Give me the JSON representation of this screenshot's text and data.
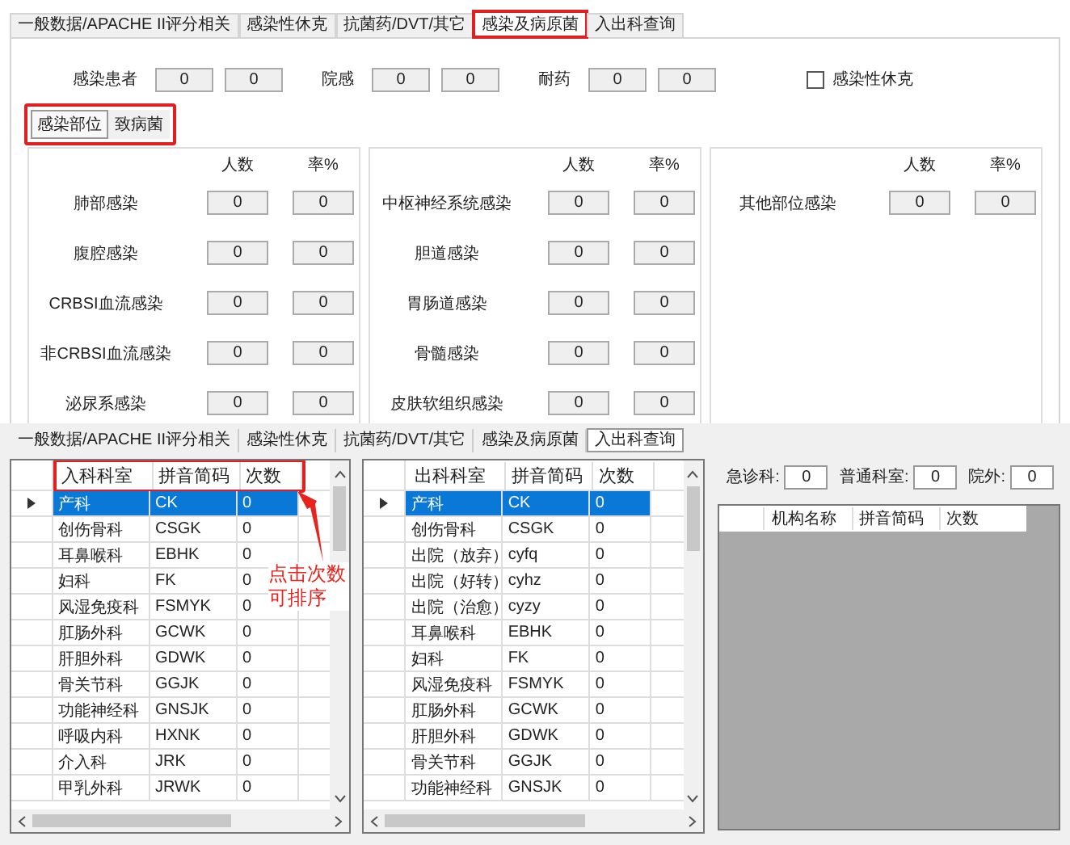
{
  "top": {
    "tabs": [
      {
        "label": "一般数据/APACHE II评分相关",
        "selected": false,
        "highlighted": false
      },
      {
        "label": "感染性休克",
        "selected": false,
        "highlighted": false
      },
      {
        "label": "抗菌药/DVT/其它",
        "selected": false,
        "highlighted": false
      },
      {
        "label": "感染及病原菌",
        "selected": true,
        "highlighted": true
      },
      {
        "label": "入出科查询",
        "selected": false,
        "highlighted": false
      }
    ],
    "counts": [
      {
        "label": "感染患者",
        "values": [
          "0",
          "0"
        ]
      },
      {
        "label": "院感",
        "values": [
          "0",
          "0"
        ]
      },
      {
        "label": "耐药",
        "values": [
          "0",
          "0"
        ]
      }
    ],
    "shock_checkbox": {
      "label": "感染性休克",
      "checked": false
    },
    "subtabs_highlighted": true,
    "subtabs": [
      {
        "label": "感染部位",
        "selected": true
      },
      {
        "label": "致病菌",
        "selected": false
      }
    ],
    "panels": [
      {
        "headers": [
          "人数",
          "率%"
        ],
        "rows": [
          {
            "label": "肺部感染",
            "values": [
              "0",
              "0"
            ]
          },
          {
            "label": "腹腔感染",
            "values": [
              "0",
              "0"
            ]
          },
          {
            "label": "CRBSI血流感染",
            "values": [
              "0",
              "0"
            ]
          },
          {
            "label": "非CRBSI血流感染",
            "values": [
              "0",
              "0"
            ]
          },
          {
            "label": "泌尿系感染",
            "values": [
              "0",
              "0"
            ]
          }
        ]
      },
      {
        "headers": [
          "人数",
          "率%"
        ],
        "rows": [
          {
            "label": "中枢神经系统感染",
            "values": [
              "0",
              "0"
            ]
          },
          {
            "label": "胆道感染",
            "values": [
              "0",
              "0"
            ]
          },
          {
            "label": "胃肠道感染",
            "values": [
              "0",
              "0"
            ]
          },
          {
            "label": "骨髓感染",
            "values": [
              "0",
              "0"
            ]
          },
          {
            "label": "皮肤软组织感染",
            "values": [
              "0",
              "0"
            ]
          }
        ]
      },
      {
        "headers": [
          "人数",
          "率%"
        ],
        "rows": [
          {
            "label": "其他部位感染",
            "values": [
              "0",
              "0"
            ]
          }
        ]
      }
    ]
  },
  "bottom": {
    "tabs": [
      {
        "label": "一般数据/APACHE II评分相关",
        "selected": false
      },
      {
        "label": "感染性休克",
        "selected": false
      },
      {
        "label": "抗菌药/DVT/其它",
        "selected": false
      },
      {
        "label": "感染及病原菌",
        "selected": false
      },
      {
        "label": "入出科查询",
        "selected": true
      }
    ],
    "grids": [
      {
        "header_highlighted": true,
        "columns": [
          "入科科室",
          "拼音简码",
          "次数"
        ],
        "rows": [
          {
            "cells": [
              "产科",
              "CK",
              "0"
            ],
            "selected": true,
            "current": true
          },
          {
            "cells": [
              "创伤骨科",
              "CSGK",
              "0"
            ],
            "selected": false,
            "current": false
          },
          {
            "cells": [
              "耳鼻喉科",
              "EBHK",
              "0"
            ],
            "selected": false,
            "current": false
          },
          {
            "cells": [
              "妇科",
              "FK",
              "0"
            ],
            "selected": false,
            "current": false
          },
          {
            "cells": [
              "风湿免疫科",
              "FSMYK",
              "0"
            ],
            "selected": false,
            "current": false
          },
          {
            "cells": [
              "肛肠外科",
              "GCWK",
              "0"
            ],
            "selected": false,
            "current": false
          },
          {
            "cells": [
              "肝胆外科",
              "GDWK",
              "0"
            ],
            "selected": false,
            "current": false
          },
          {
            "cells": [
              "骨关节科",
              "GGJK",
              "0"
            ],
            "selected": false,
            "current": false
          },
          {
            "cells": [
              "功能神经科",
              "GNSJK",
              "0"
            ],
            "selected": false,
            "current": false
          },
          {
            "cells": [
              "呼吸内科",
              "HXNK",
              "0"
            ],
            "selected": false,
            "current": false
          },
          {
            "cells": [
              "介入科",
              "JRK",
              "0"
            ],
            "selected": false,
            "current": false
          },
          {
            "cells": [
              "甲乳外科",
              "JRWK",
              "0"
            ],
            "selected": false,
            "current": false
          }
        ]
      },
      {
        "header_highlighted": false,
        "columns": [
          "出科科室",
          "拼音简码",
          "次数"
        ],
        "rows": [
          {
            "cells": [
              "产科",
              "CK",
              "0"
            ],
            "selected": true,
            "current": true
          },
          {
            "cells": [
              "创伤骨科",
              "CSGK",
              "0"
            ],
            "selected": false,
            "current": false
          },
          {
            "cells": [
              "出院（放弃）",
              "cyfq",
              "0"
            ],
            "selected": false,
            "current": false
          },
          {
            "cells": [
              "出院（好转）",
              "cyhz",
              "0"
            ],
            "selected": false,
            "current": false
          },
          {
            "cells": [
              "出院（治愈）",
              "cyzy",
              "0"
            ],
            "selected": false,
            "current": false
          },
          {
            "cells": [
              "耳鼻喉科",
              "EBHK",
              "0"
            ],
            "selected": false,
            "current": false
          },
          {
            "cells": [
              "妇科",
              "FK",
              "0"
            ],
            "selected": false,
            "current": false
          },
          {
            "cells": [
              "风湿免疫科",
              "FSMYK",
              "0"
            ],
            "selected": false,
            "current": false
          },
          {
            "cells": [
              "肛肠外科",
              "GCWK",
              "0"
            ],
            "selected": false,
            "current": false
          },
          {
            "cells": [
              "肝胆外科",
              "GDWK",
              "0"
            ],
            "selected": false,
            "current": false
          },
          {
            "cells": [
              "骨关节科",
              "GGJK",
              "0"
            ],
            "selected": false,
            "current": false
          },
          {
            "cells": [
              "功能神经科",
              "GNSJK",
              "0"
            ],
            "selected": false,
            "current": false
          }
        ]
      }
    ],
    "summary": [
      {
        "label": "急诊科:",
        "value": "0"
      },
      {
        "label": "普通科室:",
        "value": "0"
      },
      {
        "label": "院外:",
        "value": "0"
      }
    ],
    "org_grid": {
      "columns": [
        "机构名称",
        "拼音简码",
        "次数"
      ]
    },
    "annotation": "点击次数可排序"
  }
}
